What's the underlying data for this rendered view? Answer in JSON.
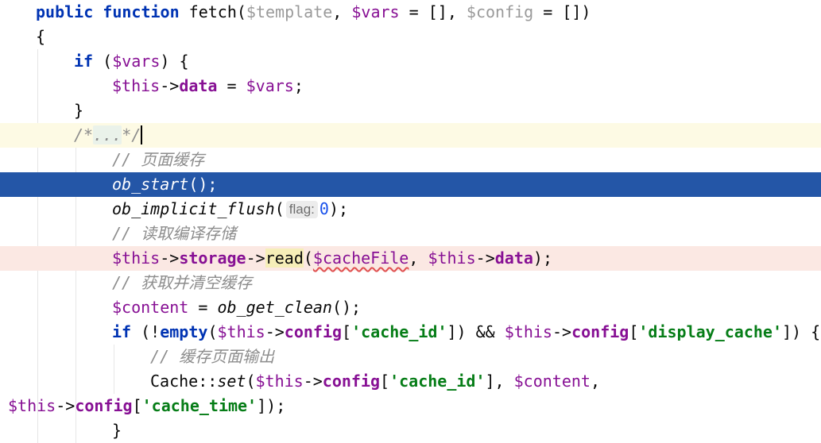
{
  "colors": {
    "keyword": "#0033b3",
    "variable": "#871094",
    "string": "#067d17",
    "number": "#1750eb",
    "comment": "#8c8c8c",
    "selection": "#2456a7",
    "caret_line": "#fdfae4",
    "error_line": "#fbe8e3"
  },
  "lines": {
    "l1": {
      "kw_public": "public",
      "kw_function": "function",
      "fn_name": " fetch(",
      "p_template": "$template",
      "sep1": ", ",
      "p_vars": "$vars",
      "eq1": " = [], ",
      "p_config": "$config",
      "eq2": " = [])"
    },
    "l2": {
      "text": "{"
    },
    "l3": {
      "kw_if": "if",
      "open": " (",
      "v_vars": "$vars",
      "close": ") {"
    },
    "l4": {
      "v_this": "$this",
      "arrow": "->",
      "f_data": "data",
      "eq": " = ",
      "v_vars": "$vars",
      "end": ";"
    },
    "l5": {
      "text": "}"
    },
    "l6": {
      "fold_prefix": "/*",
      "fold_text": "...",
      "fold_suffix": "*/"
    },
    "l7": {
      "comment": "// 页面缓存"
    },
    "l8": {
      "fn": "ob_start",
      "rest": "();"
    },
    "l9": {
      "fn": "ob_implicit_flush",
      "open": "(",
      "hint": "flag:",
      "num": "0",
      "close": ");"
    },
    "l10": {
      "comment": "// 读取编译存储"
    },
    "l11": {
      "v_this": "$this",
      "arrow1": "->",
      "f_storage": "storage",
      "arrow2": "->",
      "m_read": "read",
      "open": "(",
      "v_cachefile": "$cacheFile",
      "sep": ", ",
      "v_this2": "$this",
      "arrow3": "->",
      "f_data": "data",
      "close": ");"
    },
    "l12": {
      "comment": "// 获取并清空缓存"
    },
    "l13": {
      "v_content": "$content",
      "eq": " = ",
      "fn": "ob_get_clean",
      "rest": "();"
    },
    "l14": {
      "kw_if": "if",
      "open": " (!",
      "kw_empty": "empty",
      "p1": "(",
      "v_this": "$this",
      "arrow1": "->",
      "f_config": "config",
      "b1": "[",
      "s_cache_id": "'cache_id'",
      "b2": "]) && ",
      "v_this2": "$this",
      "arrow2": "->",
      "f_config2": "config",
      "b3": "[",
      "s_display": "'display_cache'",
      "end": "]) {"
    },
    "l15": {
      "comment": "// 缓存页面输出"
    },
    "l16": {
      "cls": "Cache",
      "dc": "::",
      "m_set": "set",
      "open": "(",
      "v_this": "$this",
      "arrow": "->",
      "f_config": "config",
      "b1": "[",
      "s_cache_id": "'cache_id'",
      "b2": "], ",
      "v_content": "$content",
      "tail": ","
    },
    "l17": {
      "v_this": "$this",
      "arrow": "->",
      "f_config": "config",
      "b1": "[",
      "s_cache_time": "'cache_time'",
      "end": "]);"
    },
    "l18": {
      "text": "}"
    }
  }
}
